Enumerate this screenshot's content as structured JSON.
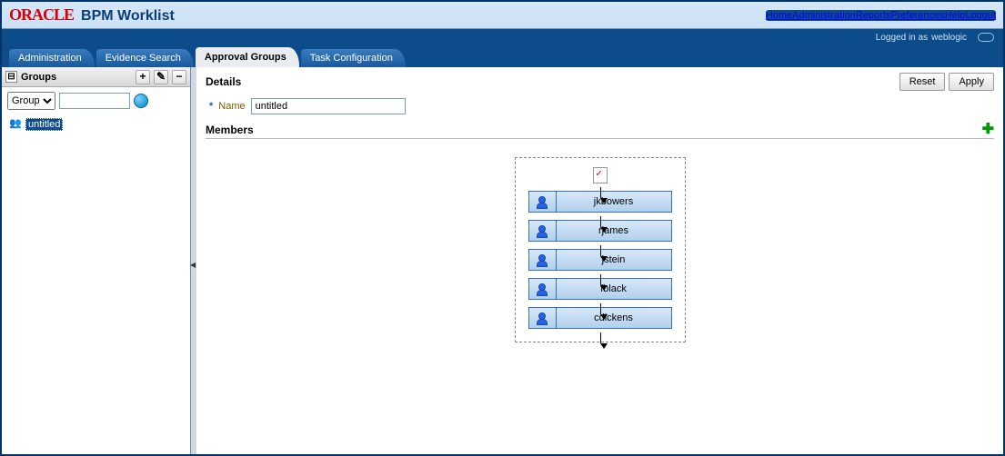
{
  "header": {
    "logo_text": "ORACLE",
    "app_title": "BPM Worklist",
    "nav": {
      "home": "Home",
      "administration": "Administration",
      "reports": "Reports",
      "preferences": "Preferences",
      "help": "Help",
      "logout": "Logout"
    },
    "login_prefix": "Logged in as",
    "login_user": "weblogic"
  },
  "tabs": {
    "administration": "Administration",
    "evidence_search": "Evidence Search",
    "approval_groups": "Approval Groups",
    "task_configuration": "Task Configuration"
  },
  "left": {
    "panel_title": "Groups",
    "collapse_glyph": "⊟",
    "add_glyph": "+",
    "edit_glyph": "✎",
    "minus_glyph": "−",
    "filter_options": [
      "Group"
    ],
    "filter_selected": "Group",
    "filter_value": "",
    "tree": [
      {
        "label": "untitled"
      }
    ]
  },
  "details": {
    "section_title": "Details",
    "reset_btn": "Reset",
    "apply_btn": "Apply",
    "name_label": "Name",
    "name_value": "untitled",
    "members_title": "Members",
    "add_title": "Add member",
    "members": [
      {
        "name": "jkbowers"
      },
      {
        "name": "rjames"
      },
      {
        "name": "jstein"
      },
      {
        "name": "fblack"
      },
      {
        "name": "cdickens"
      }
    ]
  }
}
